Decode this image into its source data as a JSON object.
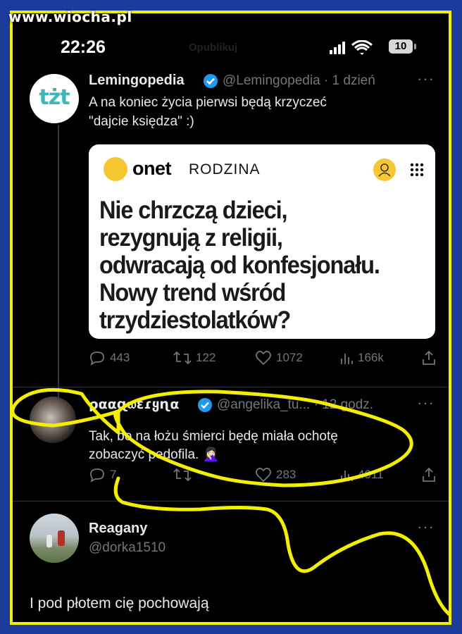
{
  "watermark": "www.wiocha.pl",
  "status_bar": {
    "time": "22:26",
    "ghost_title": "Opublikuj",
    "battery": "10"
  },
  "tweet1": {
    "name": "Lemingopedia",
    "handle": "@Lemingopedia · 1 dzień",
    "avatar_text": "tżt",
    "text_line1": "A na koniec życia pierwsi będą krzyczeć",
    "text_line2": "\"dajcie księdza\" :)",
    "card": {
      "brand": "onet",
      "section": "RODZINA",
      "headline_l1": "Nie chrzczą dzieci,",
      "headline_l2": "rezygnują z religii,",
      "headline_l3": "odwracają od konfesjonału.",
      "headline_l4": "Nowy trend wśród",
      "headline_l5": "trzydziestolatków?"
    },
    "actions": {
      "replies": "443",
      "retweets": "122",
      "likes": "1072",
      "views": "166k"
    }
  },
  "tweet2": {
    "name": "ρααɋ𝔴ɛɾყɳα",
    "handle": "@angelika_tu... · 12 godz.",
    "text_line1": "Tak, bo na łożu śmierci będę miała ochotę",
    "text_line2": "zobaczyć pedofila. 🤦🏻‍♀️",
    "actions": {
      "replies": "7",
      "retweets": "",
      "likes": "283",
      "views": "4011"
    }
  },
  "tweet3": {
    "name": "Reagany",
    "handle": "@dorka1510",
    "text": "I pod płotem cię pochowają"
  },
  "colors": {
    "frame_blue": "#1b3c9c",
    "frame_yellow": "#f4ef00",
    "verified": "#1d9bf0",
    "onet_yellow": "#f6c730"
  }
}
